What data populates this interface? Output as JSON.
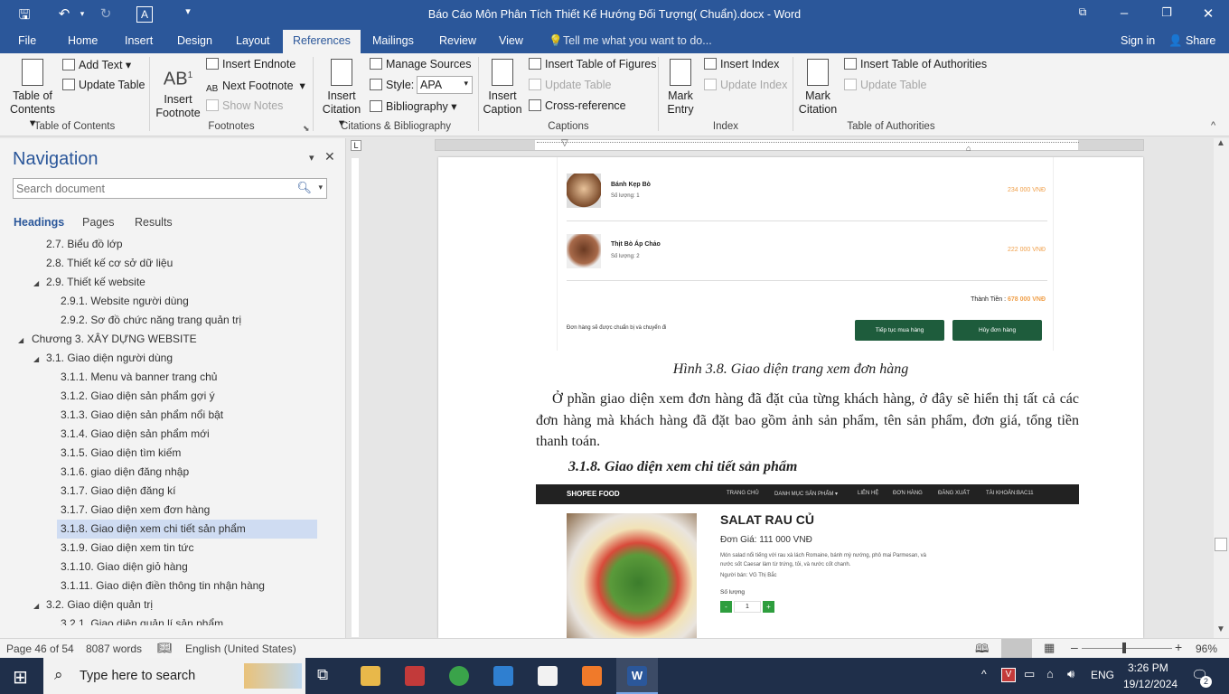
{
  "window": {
    "title": "Báo Cáo Môn Phân Tích Thiết Kế Hướng Đối Tượng( Chuẩn).docx - Word"
  },
  "tabs": [
    "File",
    "Home",
    "Insert",
    "Design",
    "Layout",
    "References",
    "Mailings",
    "Review",
    "View"
  ],
  "tell_me": "Tell me what you want to do...",
  "sign_in": "Sign in",
  "share": "Share",
  "ribbon": {
    "toc": {
      "big": "Table of Contents",
      "add_text": "Add Text",
      "update_table": "Update Table",
      "group": "Table of Contents"
    },
    "footnotes": {
      "insert_footnote": "Insert Footnote",
      "insert_endnote": "Insert Endnote",
      "next_footnote": "Next Footnote",
      "show_notes": "Show Notes",
      "group": "Footnotes"
    },
    "citations": {
      "insert_citation": "Insert Citation",
      "manage_sources": "Manage Sources",
      "style_label": "Style:",
      "style_value": "APA",
      "bibliography": "Bibliography",
      "group": "Citations & Bibliography"
    },
    "captions": {
      "insert_caption": "Insert Caption",
      "insert_tof": "Insert Table of Figures",
      "update_table": "Update Table",
      "cross_ref": "Cross-reference",
      "group": "Captions"
    },
    "index": {
      "mark_entry": "Mark Entry",
      "insert_index": "Insert Index",
      "update_index": "Update Index",
      "group": "Index"
    },
    "toa": {
      "mark_citation": "Mark Citation",
      "insert_toa": "Insert Table of Authorities",
      "update_table": "Update Table",
      "group": "Table of Authorities"
    }
  },
  "nav": {
    "title": "Navigation",
    "search_placeholder": "Search document",
    "tabs": [
      "Headings",
      "Pages",
      "Results"
    ],
    "headings": [
      "2.7. Biểu đồ lớp",
      "2.8. Thiết kế cơ sở dữ liệu",
      "2.9. Thiết kế website",
      "2.9.1. Website người dùng",
      "2.9.2. Sơ đồ chức năng trang quản trị",
      "Chương 3. XÂY DỰNG WEBSITE",
      "3.1. Giao diện người dùng",
      "3.1.1. Menu và banner trang chủ",
      "3.1.2. Giao diện sản phẩm gợi ý",
      "3.1.3. Giao diện sản phẩm nổi bật",
      "3.1.4. Giao diện sản phẩm mới",
      "3.1.5. Giao diện tìm kiếm",
      "3.1.6. giao diện đăng nhập",
      "3.1.7. Giao diện đăng kí",
      "3.1.7. Giao diện xem đơn hàng",
      "3.1.8. Giao diện xem chi tiết sản phẩm",
      "3.1.9. Giao diện xem tin tức",
      "3.1.10. Giao diện giỏ hàng",
      "3.1.11. Giao diện điền thông tin nhận hàng",
      "3.2. Giao diện quản trị",
      "3.2.1. Giao diện quản lí sản phẩm"
    ]
  },
  "doc": {
    "order_items": [
      {
        "name": "Bánh Kẹp Bò",
        "qty": "Số lượng: 1",
        "price": "234 000 VNĐ"
      },
      {
        "name": "Thịt Bò Áp Chảo",
        "qty": "Số lượng: 2",
        "price": "222 000 VNĐ"
      }
    ],
    "total_label": "Thành Tiền :",
    "total_value": "678 000 VNĐ",
    "order_note": "Đơn hàng sẽ được chuẩn bị và chuyển đi",
    "btn_continue": "Tiếp tục mua hàng",
    "btn_cancel": "Hủy đơn hàng",
    "caption": "Hình 3.8. Giao diện trang xem đơn hàng",
    "paragraph": "Ở phần giao diện xem đơn hàng đã đặt của từng khách hàng, ở đây sẽ hiển thị tất cả các đơn hàng mà khách hàng đã đặt bao gồm ảnh sản phẩm, tên sản phẩm, đơn giá, tổng tiền thanh toán.",
    "heading": "3.1.8. Giao diện xem chi tiết sản phẩm",
    "site_brand": "SHOPEE FOOD",
    "site_menu": [
      "TRANG CHỦ",
      "DANH MỤC SẢN PHẨM ▾",
      "LIÊN HỆ",
      "ĐƠN HÀNG",
      "ĐĂNG XUẤT",
      "TÀI KHOẢN:BAC11"
    ],
    "product_name": "SALAT RAU CỦ",
    "product_price": "Đơn Giá: 111 000 VNĐ",
    "product_desc": "Món salad nổi tiếng với rau xà lách Romaine, bánh mỳ nướng, phô mai Parmesan, và nước sốt Caesar làm từ trứng, tỏi, và nước cốt chanh.",
    "product_seller": "Người bán: VG Thị Bắc",
    "qty_label": "Số lượng",
    "qty_minus": "-",
    "qty_value": "1",
    "qty_plus": "+"
  },
  "status": {
    "page": "Page 46 of 54",
    "words": "8087 words",
    "language": "English (United States)",
    "zoom": "96%"
  },
  "taskbar": {
    "search": "Type here to search",
    "lang": "ENG",
    "time": "3:26 PM",
    "date": "19/12/2024",
    "notif": "2"
  },
  "colors": {
    "accent": "#2b579a",
    "site_green": "#1e5c3c",
    "price_orange": "#f0a04b",
    "selected": "#cfdcf2"
  }
}
